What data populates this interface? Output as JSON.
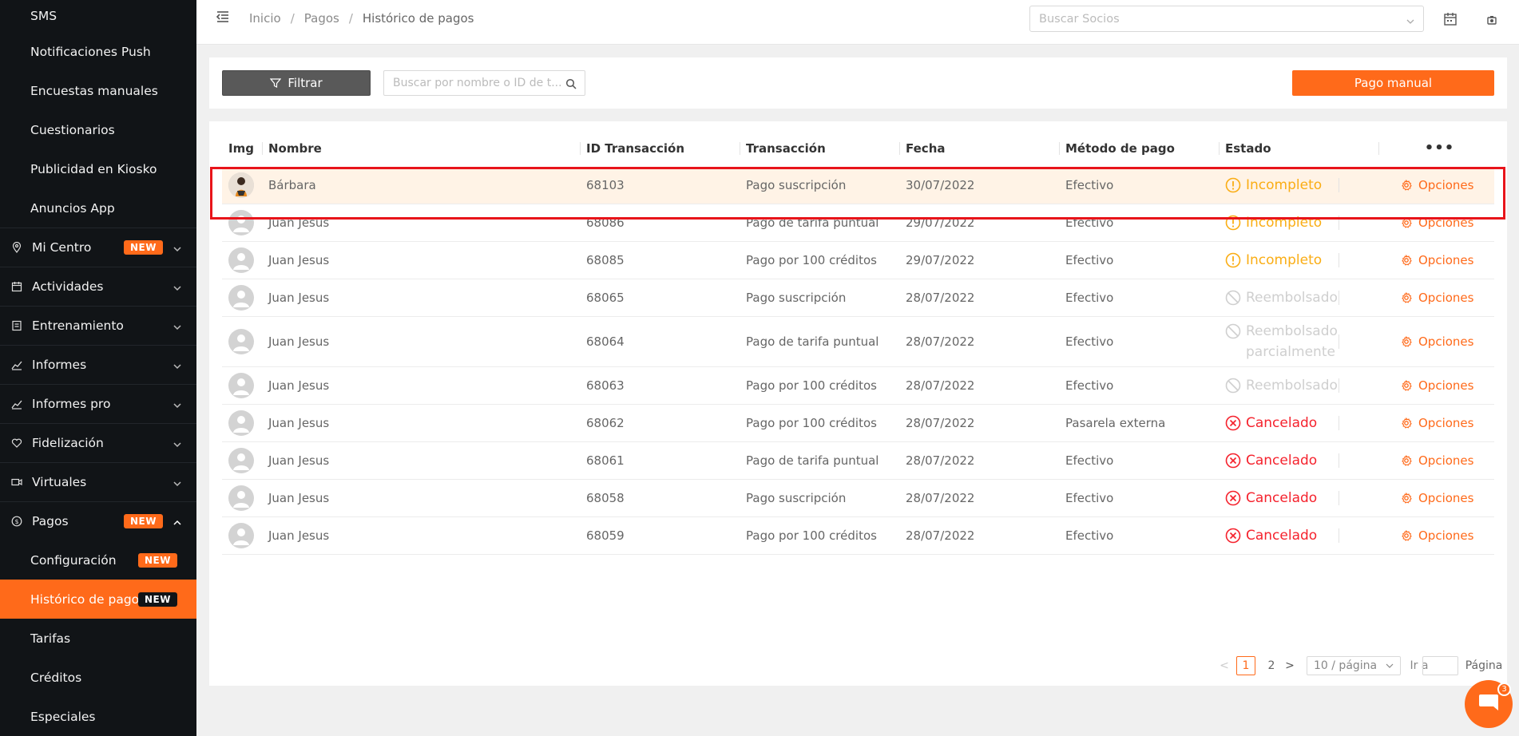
{
  "sidebar": {
    "items": [
      {
        "label": "SMS",
        "kind": "sub"
      },
      {
        "label": "Notificaciones Push",
        "kind": "sub"
      },
      {
        "label": "Encuestas manuales",
        "kind": "sub"
      },
      {
        "label": "Cuestionarios",
        "kind": "sub"
      },
      {
        "label": "Publicidad en Kiosko",
        "kind": "sub"
      },
      {
        "label": "Anuncios App",
        "kind": "sub"
      },
      {
        "label": "Mi Centro",
        "kind": "top",
        "icon": "location-pin-icon",
        "badge": "NEW"
      },
      {
        "label": "Actividades",
        "kind": "top",
        "icon": "calendar-icon"
      },
      {
        "label": "Entrenamiento",
        "kind": "top",
        "icon": "clipboard-icon"
      },
      {
        "label": "Informes",
        "kind": "top",
        "icon": "line-chart-icon"
      },
      {
        "label": "Informes pro",
        "kind": "top",
        "icon": "line-chart-icon"
      },
      {
        "label": "Fidelización",
        "kind": "top",
        "icon": "heart-icon"
      },
      {
        "label": "Virtuales",
        "kind": "top",
        "icon": "video-camera-icon"
      },
      {
        "label": "Pagos",
        "kind": "top",
        "icon": "dollar-circle-icon",
        "badge": "NEW",
        "open": true
      },
      {
        "label": "Configuración",
        "kind": "sub",
        "badge": "NEW"
      },
      {
        "label": "Histórico de pagos",
        "kind": "sub",
        "badge": "NEW",
        "active": true
      },
      {
        "label": "Tarifas",
        "kind": "sub"
      },
      {
        "label": "Créditos",
        "kind": "sub"
      },
      {
        "label": "Especiales",
        "kind": "sub"
      }
    ]
  },
  "header": {
    "breadcrumb": [
      "Inicio",
      "Pagos",
      "Histórico de pagos"
    ],
    "breadcrumb_sep": "/",
    "search_placeholder": "Buscar Socios"
  },
  "toolbar": {
    "filter_label": "Filtrar",
    "search_placeholder": "Buscar por nombre o ID de t...",
    "manual_payment_label": "Pago manual"
  },
  "table": {
    "columns": [
      "Img",
      "Nombre",
      "ID Transacción",
      "Transacción",
      "Fecha",
      "Método de pago",
      "Estado",
      "•••"
    ],
    "rows": [
      {
        "name": "Bárbara",
        "id": "68103",
        "transaction": "Pago suscripción",
        "date": "30/07/2022",
        "method": "Efectivo",
        "status": "Incompleto",
        "status_type": "incompleto",
        "action": "Opciones",
        "avatar": "photo",
        "highlight": true
      },
      {
        "name": "Juan Jesus",
        "id": "68086",
        "transaction": "Pago de tarifa puntual",
        "date": "29/07/2022",
        "method": "Efectivo",
        "status": "Incompleto",
        "status_type": "incompleto",
        "action": "Opciones"
      },
      {
        "name": "Juan Jesus",
        "id": "68085",
        "transaction": "Pago por 100 créditos",
        "date": "29/07/2022",
        "method": "Efectivo",
        "status": "Incompleto",
        "status_type": "incompleto",
        "action": "Opciones"
      },
      {
        "name": "Juan Jesus",
        "id": "68065",
        "transaction": "Pago suscripción",
        "date": "28/07/2022",
        "method": "Efectivo",
        "status": "Reembolsado",
        "status_type": "reembolsado",
        "action": "Opciones"
      },
      {
        "name": "Juan Jesus",
        "id": "68064",
        "transaction": "Pago de tarifa puntual",
        "date": "28/07/2022",
        "method": "Efectivo",
        "status": "Reembolsado parcialmente",
        "status_type": "reembolsado",
        "action": "Opciones",
        "tall": true
      },
      {
        "name": "Juan Jesus",
        "id": "68063",
        "transaction": "Pago por 100 créditos",
        "date": "28/07/2022",
        "method": "Efectivo",
        "status": "Reembolsado",
        "status_type": "reembolsado",
        "action": "Opciones"
      },
      {
        "name": "Juan Jesus",
        "id": "68062",
        "transaction": "Pago por 100 créditos",
        "date": "28/07/2022",
        "method": "Pasarela externa",
        "status": "Cancelado",
        "status_type": "cancelado",
        "action": "Opciones"
      },
      {
        "name": "Juan Jesus",
        "id": "68061",
        "transaction": "Pago de tarifa puntual",
        "date": "28/07/2022",
        "method": "Efectivo",
        "status": "Cancelado",
        "status_type": "cancelado",
        "action": "Opciones"
      },
      {
        "name": "Juan Jesus",
        "id": "68058",
        "transaction": "Pago suscripción",
        "date": "28/07/2022",
        "method": "Efectivo",
        "status": "Cancelado",
        "status_type": "cancelado",
        "action": "Opciones"
      },
      {
        "name": "Juan Jesus",
        "id": "68059",
        "transaction": "Pago por 100 créditos",
        "date": "28/07/2022",
        "method": "Efectivo",
        "status": "Cancelado",
        "status_type": "cancelado",
        "action": "Opciones"
      }
    ]
  },
  "pagination": {
    "prev": "<",
    "pages": [
      "1",
      "2"
    ],
    "current": "1",
    "next": ">",
    "page_size": "10 / página",
    "goto_label": "Ir a",
    "page_label": "Página"
  },
  "chat": {
    "badge_count": "3"
  },
  "colors": {
    "accent": "#ff6a1a",
    "sidebar_bg": "#111417",
    "incompleto": "#faad14",
    "reembolsado": "#cfcfcf",
    "cancelado": "#f5222d",
    "highlight_border": "#e8141a"
  }
}
